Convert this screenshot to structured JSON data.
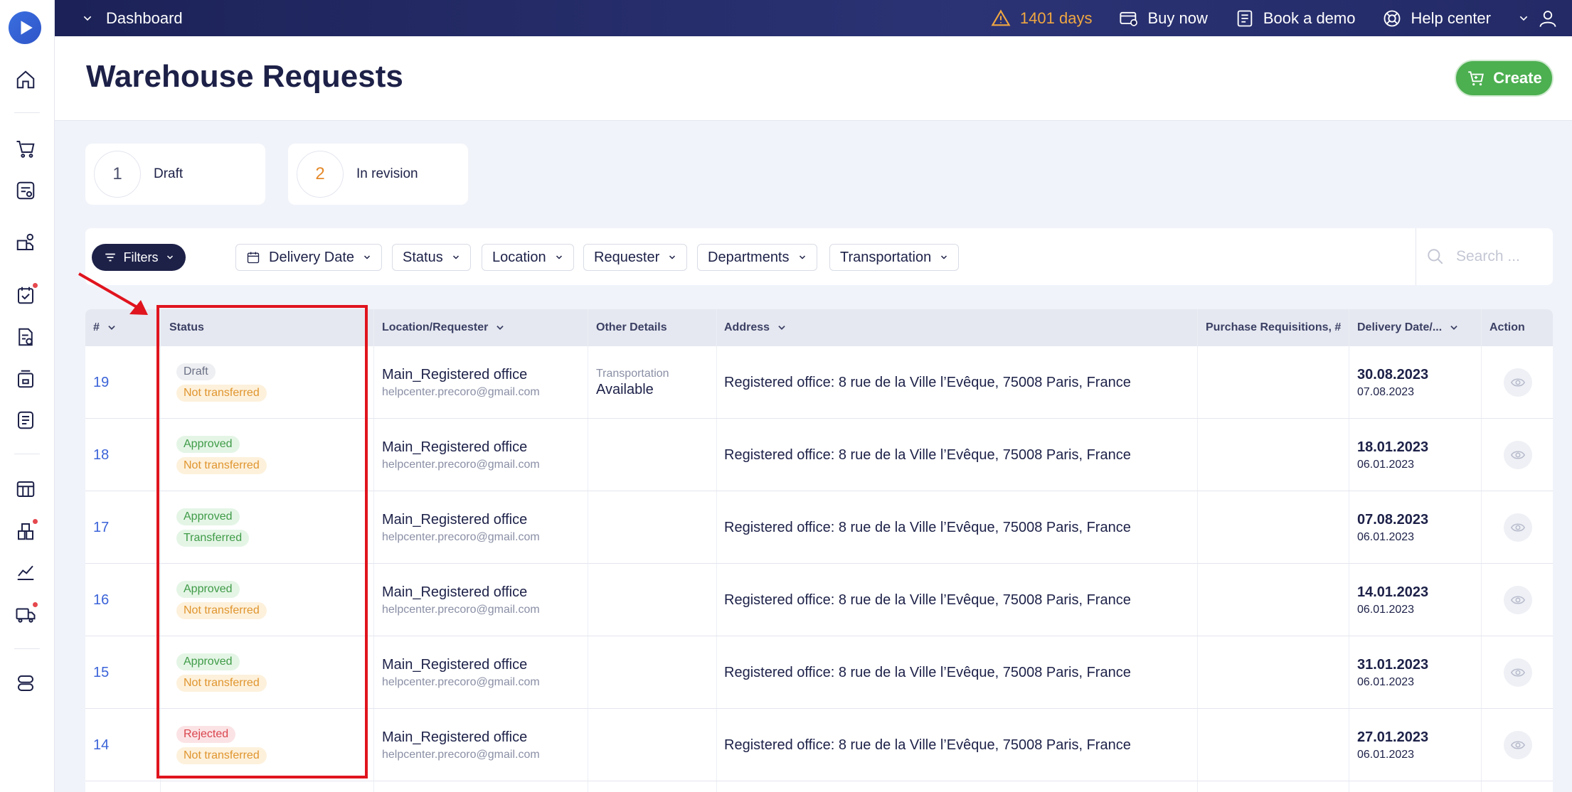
{
  "colors": {
    "accent": "#1d2148",
    "link": "#3b63d8",
    "create": "#4caf50",
    "warning": "#f0a741",
    "highlight": "#e0141e"
  },
  "sidebar": {
    "logo": "play-logo",
    "icons": [
      "home-icon",
      "cart-icon",
      "requests-icon",
      "supplier-icon",
      "approval-icon",
      "invoice-icon",
      "warehouse-icon",
      "receipt-icon",
      "budget-icon",
      "inventory-icon",
      "analytics-icon",
      "delivery-icon",
      "settings-icon"
    ]
  },
  "topbar": {
    "dashboard": "Dashboard",
    "trial": "1401 days",
    "buy": "Buy now",
    "demo": "Book a demo",
    "help": "Help center"
  },
  "header": {
    "title": "Warehouse Requests",
    "create": "Create"
  },
  "stats": [
    {
      "count": "1",
      "label": "Draft"
    },
    {
      "count": "2",
      "label": "In revision"
    }
  ],
  "filters": {
    "button": "Filters",
    "pills": [
      "Delivery Date",
      "Status",
      "Location",
      "Requester",
      "Departments",
      "Transportation"
    ],
    "search_placeholder": "Search ..."
  },
  "table": {
    "columns": [
      "#",
      "Status",
      "Location/Requester",
      "Other Details",
      "Address",
      "Purchase Requisitions, #",
      "Delivery Date/...",
      "Action"
    ],
    "rows": [
      {
        "id": "19",
        "status": "Draft",
        "status_type": "draft",
        "transfer": "Not transferred",
        "transfer_type": "not",
        "location": "Main_Registered office",
        "requester": "helpcenter.precoro@gmail.com",
        "other_label": "Transportation",
        "other_value": "Available",
        "address": "Registered office: 8 rue de la Ville l’Evêque, 75008 Paris, France",
        "pr": "",
        "delivery": "30.08.2023",
        "created": "07.08.2023"
      },
      {
        "id": "18",
        "status": "Approved",
        "status_type": "approved",
        "transfer": "Not transferred",
        "transfer_type": "not",
        "location": "Main_Registered office",
        "requester": "helpcenter.precoro@gmail.com",
        "other_label": "",
        "other_value": "",
        "address": "Registered office: 8 rue de la Ville l’Evêque, 75008 Paris, France",
        "pr": "",
        "delivery": "18.01.2023",
        "created": "06.01.2023"
      },
      {
        "id": "17",
        "status": "Approved",
        "status_type": "approved",
        "transfer": "Transferred",
        "transfer_type": "trans",
        "location": "Main_Registered office",
        "requester": "helpcenter.precoro@gmail.com",
        "other_label": "",
        "other_value": "",
        "address": "Registered office: 8 rue de la Ville l’Evêque, 75008 Paris, France",
        "pr": "",
        "delivery": "07.08.2023",
        "created": "06.01.2023"
      },
      {
        "id": "16",
        "status": "Approved",
        "status_type": "approved",
        "transfer": "Not transferred",
        "transfer_type": "not",
        "location": "Main_Registered office",
        "requester": "helpcenter.precoro@gmail.com",
        "other_label": "",
        "other_value": "",
        "address": "Registered office: 8 rue de la Ville l’Evêque, 75008 Paris, France",
        "pr": "",
        "delivery": "14.01.2023",
        "created": "06.01.2023"
      },
      {
        "id": "15",
        "status": "Approved",
        "status_type": "approved",
        "transfer": "Not transferred",
        "transfer_type": "not",
        "location": "Main_Registered office",
        "requester": "helpcenter.precoro@gmail.com",
        "other_label": "",
        "other_value": "",
        "address": "Registered office: 8 rue de la Ville l’Evêque, 75008 Paris, France",
        "pr": "",
        "delivery": "31.01.2023",
        "created": "06.01.2023"
      },
      {
        "id": "14",
        "status": "Rejected",
        "status_type": "rejected",
        "transfer": "Not transferred",
        "transfer_type": "not",
        "location": "Main_Registered office",
        "requester": "helpcenter.precoro@gmail.com",
        "other_label": "",
        "other_value": "",
        "address": "Registered office: 8 rue de la Ville l’Evêque, 75008 Paris, France",
        "pr": "",
        "delivery": "27.01.2023",
        "created": "06.01.2023"
      }
    ]
  }
}
